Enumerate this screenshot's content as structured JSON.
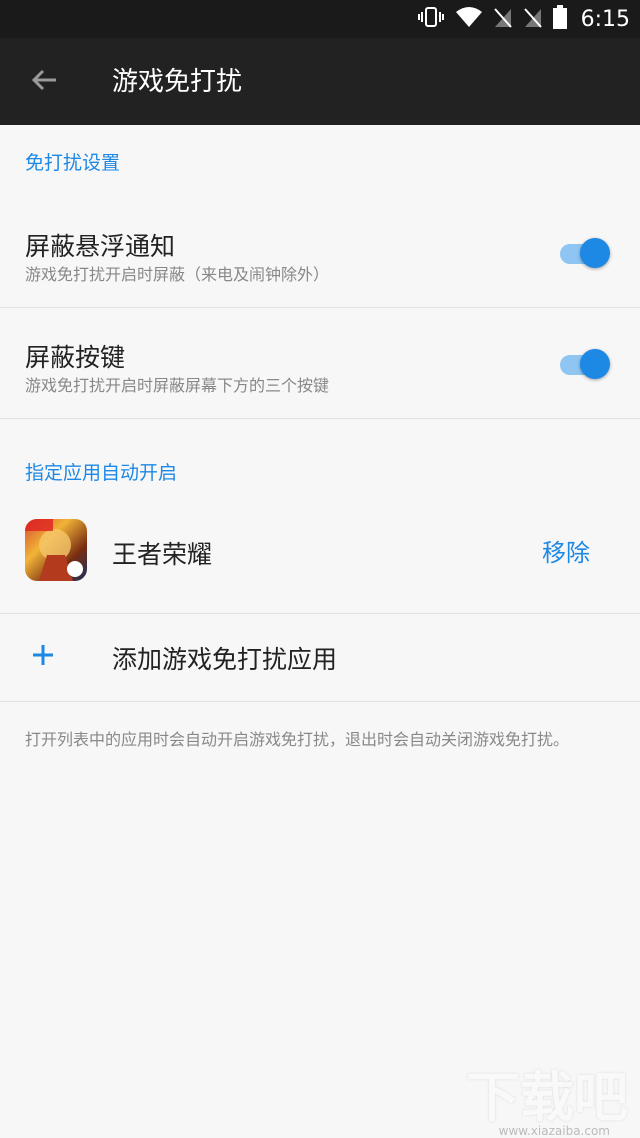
{
  "status_bar": {
    "time": "6:15",
    "icons": [
      "vibrate-icon",
      "wifi-icon",
      "no-sim-icon",
      "no-sim-icon",
      "battery-icon"
    ]
  },
  "app_bar": {
    "title": "游戏免打扰",
    "back_icon": "back-arrow-icon"
  },
  "settings": {
    "section_header": "免打扰设置",
    "items": [
      {
        "title": "屏蔽悬浮通知",
        "subtitle": "游戏免打扰开启时屏蔽（来电及闹钟除外）",
        "enabled": true
      },
      {
        "title": "屏蔽按键",
        "subtitle": "游戏免打扰开启时屏蔽屏幕下方的三个按键",
        "enabled": true
      }
    ]
  },
  "apps": {
    "section_header": "指定应用自动开启",
    "list": [
      {
        "name": "王者荣耀",
        "action": "移除"
      }
    ],
    "add_label": "添加游戏免打扰应用",
    "note": "打开列表中的应用时会自动开启游戏免打扰，退出时会自动关闭游戏免打扰。"
  },
  "watermark": {
    "text": "下载吧",
    "site": "www.xiazaiba.com"
  },
  "colors": {
    "accent": "#1e88e5",
    "toggle_track": "#8ec5f3",
    "app_bar": "#222222"
  }
}
